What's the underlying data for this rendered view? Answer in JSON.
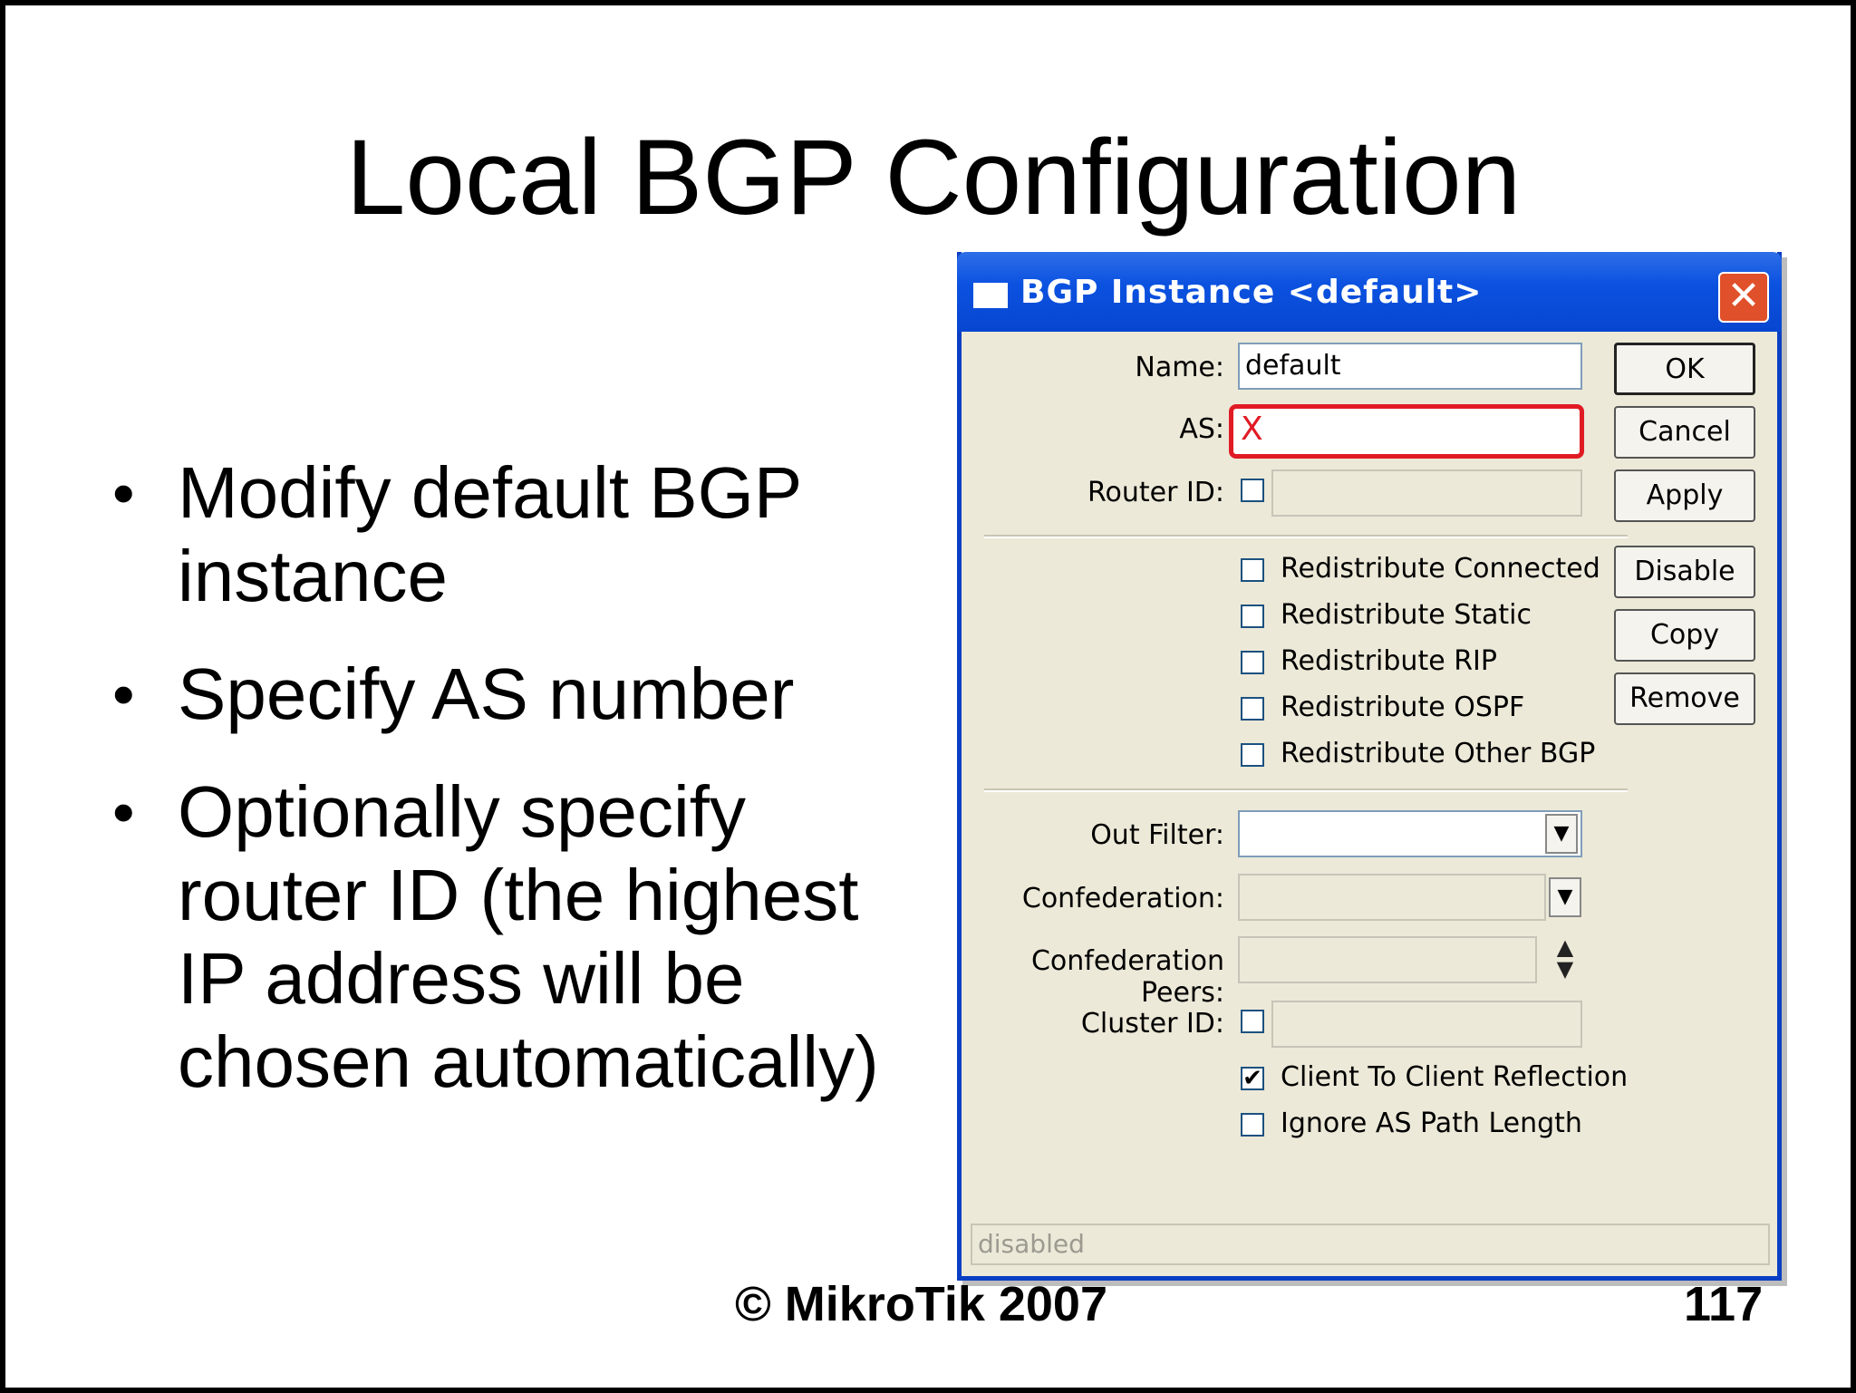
{
  "slide": {
    "title": "Local BGP Configuration",
    "bullets": [
      "Modify default BGP instance",
      "Specify AS number",
      "Optionally specify router ID (the highest IP address will be chosen automatically)"
    ],
    "copyright": "© MikroTik 2007",
    "page_number": "117"
  },
  "dialog": {
    "title": "BGP Instance <default>",
    "close_glyph": "✕",
    "fields": {
      "name_label": "Name:",
      "name_value": "default",
      "as_label": "AS:",
      "as_value": "X",
      "router_id_label": "Router ID:",
      "router_id_value": "",
      "out_filter_label": "Out Filter:",
      "out_filter_value": "",
      "confederation_label": "Confederation:",
      "confederation_value": "",
      "confederation_peers_label": "Confederation Peers:",
      "confederation_peers_value": "",
      "cluster_id_label": "Cluster ID:",
      "cluster_id_value": ""
    },
    "redistribute": [
      {
        "label": "Redistribute Connected",
        "checked": false
      },
      {
        "label": "Redistribute Static",
        "checked": false
      },
      {
        "label": "Redistribute RIP",
        "checked": false
      },
      {
        "label": "Redistribute OSPF",
        "checked": false
      },
      {
        "label": "Redistribute Other BGP",
        "checked": false
      }
    ],
    "options": [
      {
        "label": "Client To Client Reflection",
        "checked": true
      },
      {
        "label": "Ignore AS Path Length",
        "checked": false
      }
    ],
    "buttons": {
      "ok": "OK",
      "cancel": "Cancel",
      "apply": "Apply",
      "disable": "Disable",
      "copy": "Copy",
      "remove": "Remove"
    },
    "check_glyph": "✔",
    "dropdown_glyph": "▼",
    "spin_up_glyph": "▲",
    "spin_down_glyph": "▼",
    "status": "disabled"
  },
  "colors": {
    "titlebar": "#0b52e0",
    "dialog_bg": "#ece9d8",
    "highlight": "#e01b24"
  }
}
